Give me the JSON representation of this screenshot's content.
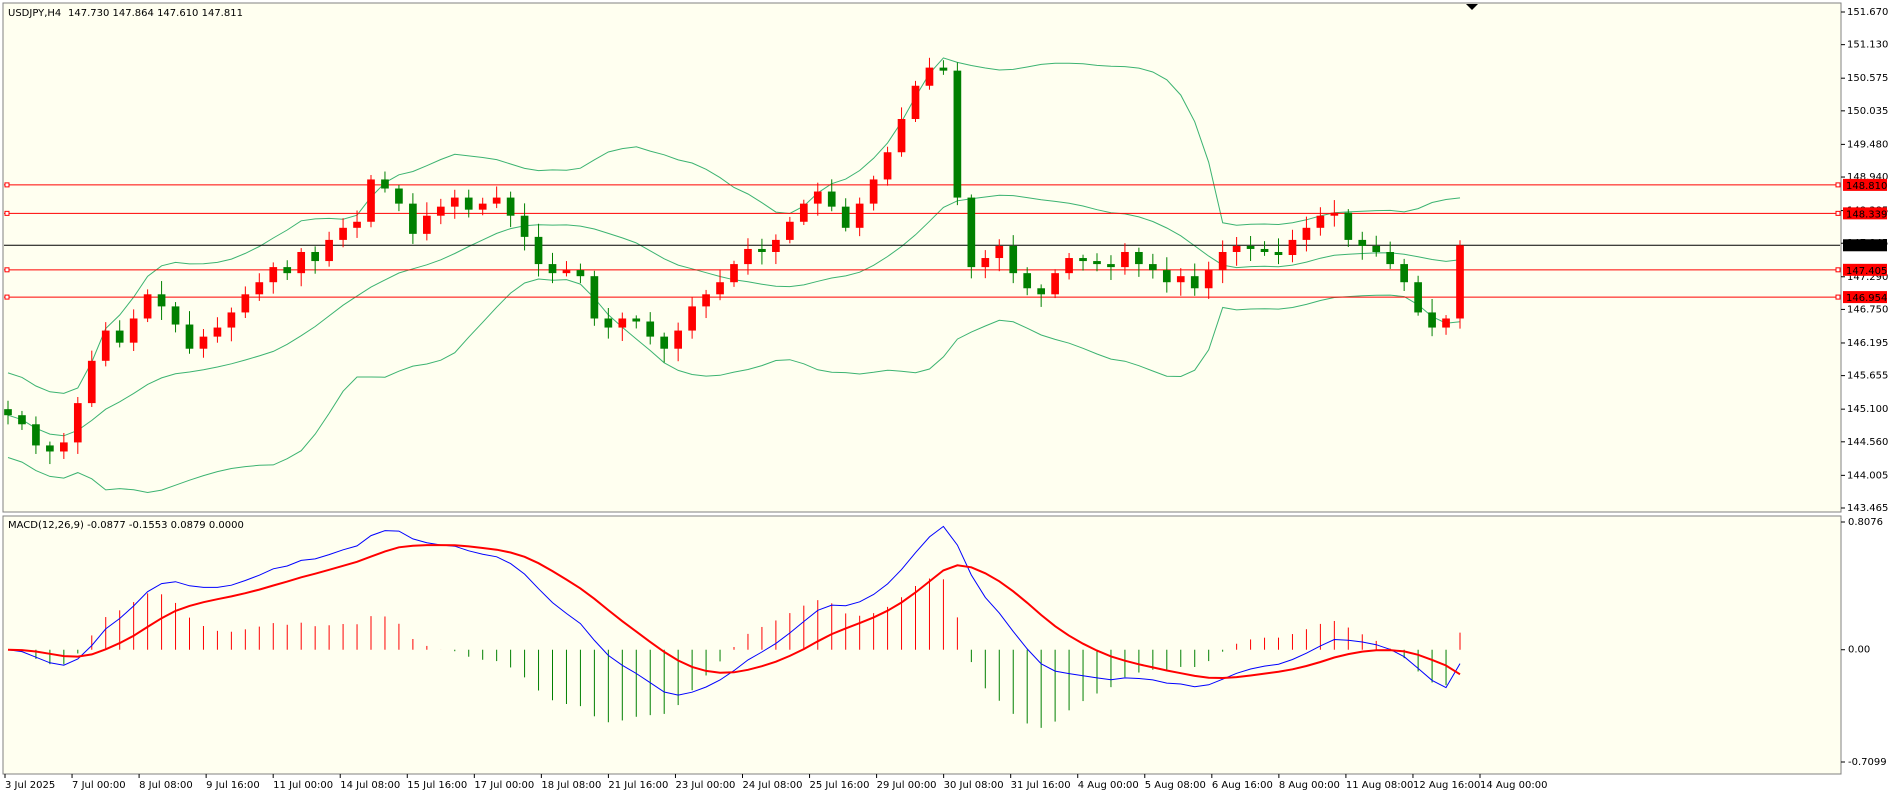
{
  "app": {
    "platform": "MetaTrader 4"
  },
  "header": {
    "symbol": "USDJPY,H4",
    "ohlc": "147.730 147.864 147.610 147.811"
  },
  "macd_header": "MACD(12,26,9) -0.0877 -0.1553 0.0879 0.0000",
  "colors": {
    "background": "#fffff0",
    "bull": "#ff0000",
    "bear": "#008000",
    "bands": "#3cb371",
    "level": "#ff0000",
    "price_line": "#000000",
    "macd_line": "#0000ff",
    "signal_line": "#ff0000",
    "hist_pos": "#ff0000",
    "hist_neg": "#008000"
  },
  "chart_data": [
    {
      "type": "candlestick",
      "symbol": "USDJPY",
      "timeframe": "H4",
      "price_ticks": [
        "151.670",
        "151.130",
        "150.575",
        "150.035",
        "149.480",
        "148.940",
        "148.385",
        "147.845",
        "147.290",
        "146.750",
        "146.195",
        "145.655",
        "145.100",
        "144.560",
        "144.005",
        "143.465"
      ],
      "price_tick_values": [
        151.67,
        151.13,
        150.575,
        150.035,
        149.48,
        148.94,
        148.385,
        147.845,
        147.29,
        146.75,
        146.195,
        145.655,
        145.1,
        144.56,
        144.005,
        143.465
      ],
      "ylim": [
        143.465,
        151.67
      ],
      "x_labels": [
        "3 Jul 2025",
        "7 Jul 00:00",
        "8 Jul 08:00",
        "9 Jul 16:00",
        "11 Jul 00:00",
        "14 Jul 08:00",
        "15 Jul 16:00",
        "17 Jul 00:00",
        "18 Jul 08:00",
        "21 Jul 16:00",
        "23 Jul 00:00",
        "24 Jul 08:00",
        "25 Jul 16:00",
        "29 Jul 00:00",
        "30 Jul 08:00",
        "31 Jul 16:00",
        "4 Aug 00:00",
        "5 Aug 08:00",
        "6 Aug 16:00",
        "8 Aug 00:00",
        "11 Aug 08:00",
        "12 Aug 16:00",
        "14 Aug 00:00"
      ],
      "price_levels": [
        {
          "label": "148.810",
          "value": 148.81
        },
        {
          "label": "148.339",
          "value": 148.339
        },
        {
          "label": "147.405",
          "value": 147.405
        },
        {
          "label": "146.954",
          "value": 146.954
        }
      ],
      "current_price": {
        "label": "147.811",
        "value": 147.811
      },
      "close_path": [
        145.0,
        144.85,
        144.5,
        144.4,
        144.55,
        145.2,
        145.9,
        146.4,
        146.2,
        146.6,
        147.0,
        146.8,
        146.5,
        146.1,
        146.3,
        146.45,
        146.7,
        147.0,
        147.2,
        147.45,
        147.35,
        147.7,
        147.55,
        147.9,
        148.1,
        148.2,
        148.9,
        148.75,
        148.5,
        148.0,
        148.3,
        148.45,
        148.6,
        148.4,
        148.5,
        148.6,
        148.3,
        147.95,
        147.5,
        147.35,
        147.4,
        147.3,
        146.6,
        146.45,
        146.6,
        146.55,
        146.3,
        146.1,
        146.4,
        146.8,
        147.0,
        147.2,
        147.5,
        147.75,
        147.7,
        147.9,
        148.2,
        148.5,
        148.7,
        148.45,
        148.1,
        148.5,
        148.9,
        149.35,
        149.9,
        150.45,
        150.75,
        150.7,
        148.6,
        147.45,
        147.6,
        147.8,
        147.35,
        147.1,
        147.0,
        147.35,
        147.6,
        147.55,
        147.5,
        147.45,
        147.7,
        147.5,
        147.4,
        147.2,
        147.3,
        147.1,
        147.4,
        147.7,
        147.8,
        147.75,
        147.7,
        147.65,
        147.9,
        148.1,
        148.3,
        148.35,
        147.9,
        147.8,
        147.7,
        147.5,
        147.2,
        146.7,
        146.45,
        146.6,
        147.811
      ]
    },
    {
      "type": "macd",
      "params": "12,26,9",
      "values": {
        "macd": -0.0877,
        "signal": -0.1553,
        "histogram": 0.0879,
        "extra": 0.0
      },
      "y_ticks": [
        "0.8076",
        "0.00",
        "-0.7099"
      ],
      "y_tick_values": [
        0.8076,
        0.0,
        -0.7099
      ],
      "ylim": [
        -0.7099,
        0.8076
      ]
    }
  ]
}
